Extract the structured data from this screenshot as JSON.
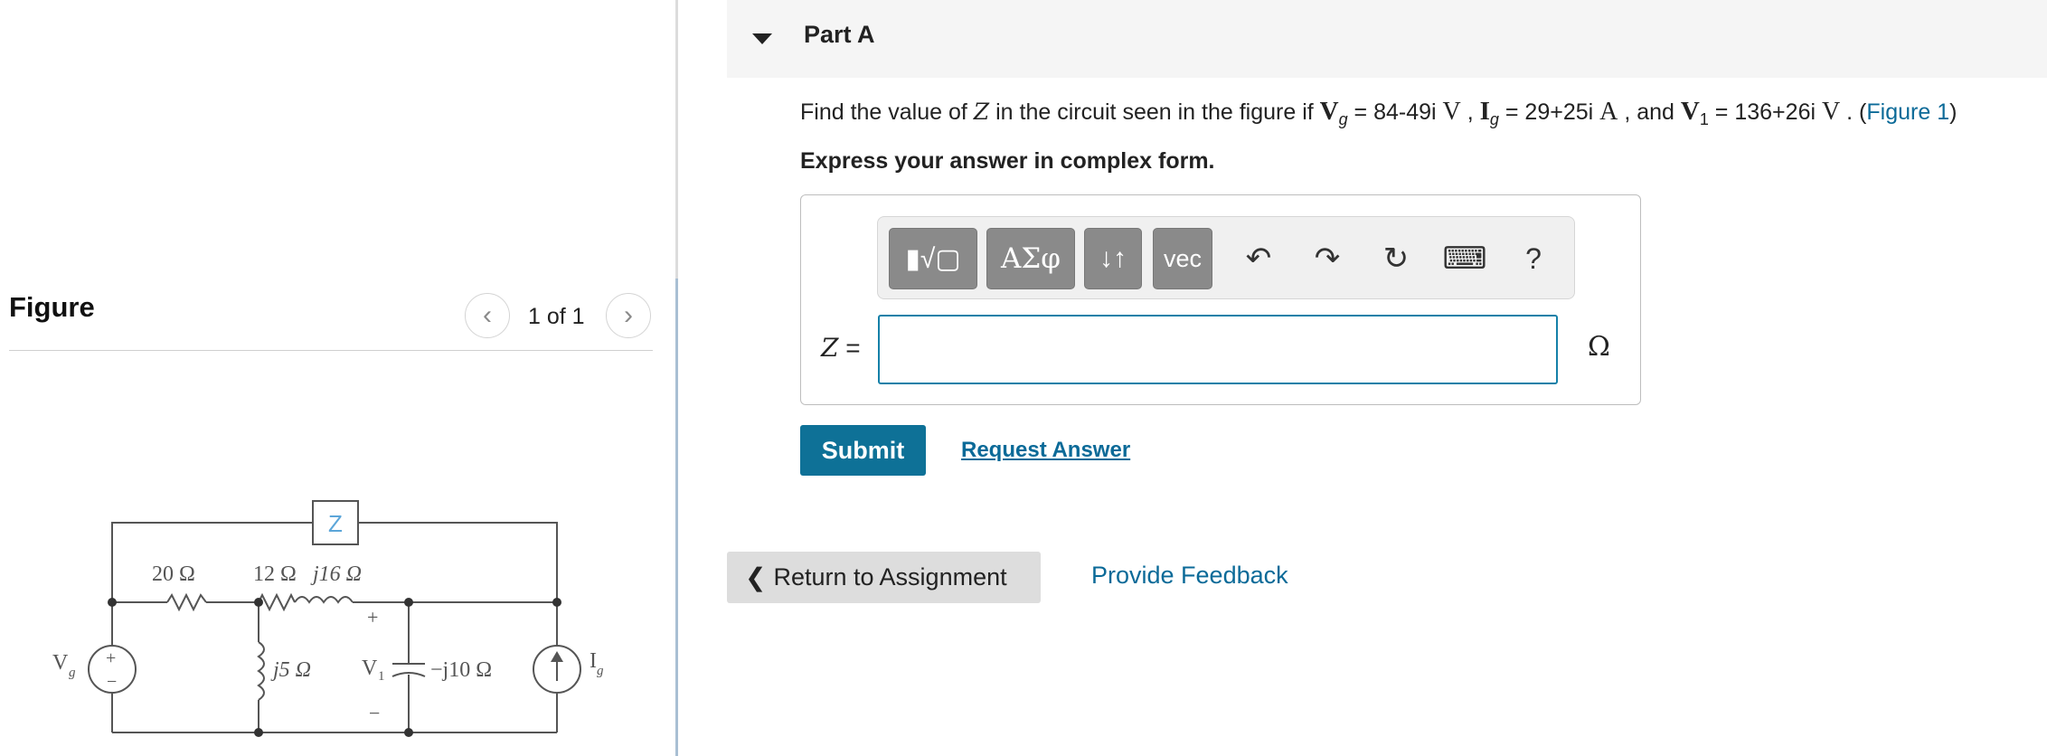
{
  "figure": {
    "title": "Figure",
    "page_indicator": "1 of 1",
    "prev_glyph": "‹",
    "next_glyph": "›",
    "circuit": {
      "z_label": "Z",
      "r1_label": "20 Ω",
      "r2_label": "12 Ω",
      "l1_label": "j16 Ω",
      "l2_label": "j5 Ω",
      "v1_label": "V",
      "v1_sub": "1",
      "c_label": "−j10 Ω",
      "vg_label": "V",
      "vg_sub": "g",
      "ig_label": "I",
      "ig_sub": "g",
      "plus": "+",
      "minus": "−"
    }
  },
  "part": {
    "title": "Part A",
    "question": {
      "q1": "Find the value of ",
      "z": "Z",
      "q2": " in the circuit seen in the figure if ",
      "vg_sym": "V",
      "vg_sub": "g",
      "vg_val": " = 84-49i ",
      "vg_unit": "V",
      "sep1": " , ",
      "ig_sym": "I",
      "ig_sub": "g",
      "ig_val": " = 29+25i ",
      "ig_unit": "A",
      "sep2": " , and ",
      "v1_sym": "V",
      "v1_sub": "1",
      "v1_val": " = 136+26i ",
      "v1_unit": "V",
      "end": " . (",
      "figure_link": "Figure 1",
      "close": ")"
    },
    "instruction": "Express your answer in complex form.",
    "toolbar": {
      "templates": "▮√▢",
      "greek": "ΑΣφ",
      "arrows": "↓↑",
      "vec": "vec",
      "undo": "↶",
      "redo": "↷",
      "reset": "↻",
      "keyboard": "⌨",
      "help": "?"
    },
    "answer": {
      "label_var": "Z",
      "label_eq": " =",
      "value": "",
      "unit": "Ω"
    },
    "submit_label": "Submit",
    "request_answer_label": "Request Answer"
  },
  "footer": {
    "return_label": "Return to Assignment",
    "return_chevron": "❮",
    "feedback_label": "Provide Feedback"
  }
}
